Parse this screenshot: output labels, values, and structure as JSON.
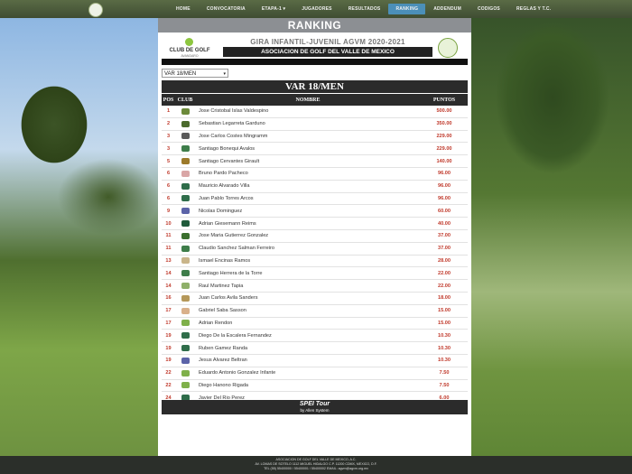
{
  "nav": {
    "items": [
      "HOME",
      "CONVOCATORIA",
      "ETAPA-1",
      "JUGADORES",
      "RESULTADOS",
      "RANKING",
      "ADDENDUM",
      "CODIGOS",
      "REGLAS Y T.C."
    ],
    "active": "RANKING",
    "dropdown_marker": "▾"
  },
  "page": {
    "title": "RANKING",
    "club_logo_text": "CLUB DE GOLF",
    "club_logo_sub": "AVANDARO",
    "gira_title": "GIRA INFANTIL-JUVENIL AGVM 2020-2021",
    "asociacion": "ASOCIACION DE GOLF DEL VALLE DE MEXICO",
    "category_select": "VAR 18/MEN",
    "category_title": "VAR 18/MEN"
  },
  "table": {
    "headers": [
      "POS",
      "CLUB",
      "NOMBRE",
      "PUNTOS"
    ],
    "rows": [
      {
        "pos": "1",
        "name": "Jose Cristobal Islas Valdespino",
        "pts": "500.00",
        "club_color": "#6c8a3a"
      },
      {
        "pos": "2",
        "name": "Sebastian Legarreta Garduno",
        "pts": "350.00",
        "club_color": "#4b6a2c"
      },
      {
        "pos": "3",
        "name": "Jose Carlos Costes Mingramm",
        "pts": "229.00",
        "club_color": "#5a5a5a"
      },
      {
        "pos": "3",
        "name": "Santiago Bonequi Avalos",
        "pts": "229.00",
        "club_color": "#3e7d4a"
      },
      {
        "pos": "5",
        "name": "Santiago Cervantes Girault",
        "pts": "140.00",
        "club_color": "#9c7a2a"
      },
      {
        "pos": "6",
        "name": "Bruno Pardo Pacheco",
        "pts": "96.00",
        "club_color": "#d9a6a6"
      },
      {
        "pos": "6",
        "name": "Mauricio Alvarado Villa",
        "pts": "96.00",
        "club_color": "#2f6d4a"
      },
      {
        "pos": "6",
        "name": "Juan Pablo Torres Arcos",
        "pts": "96.00",
        "club_color": "#2f6d4a"
      },
      {
        "pos": "9",
        "name": "Nicolas Dominguez",
        "pts": "60.00",
        "club_color": "#5b63a8"
      },
      {
        "pos": "10",
        "name": "Adrian Giesemann Reims",
        "pts": "40.00",
        "club_color": "#1f5a3a"
      },
      {
        "pos": "11",
        "name": "Jose Maria Gutierrez Gonzalez",
        "pts": "37.00",
        "club_color": "#3b6f2e"
      },
      {
        "pos": "11",
        "name": "Claudio Sanchez Salman Ferreiro",
        "pts": "37.00",
        "club_color": "#3e7d4a"
      },
      {
        "pos": "13",
        "name": "Ismael Encinas Ramos",
        "pts": "28.00",
        "club_color": "#c9b58a"
      },
      {
        "pos": "14",
        "name": "Santiago Herrera de la Torre",
        "pts": "22.00",
        "club_color": "#3e7d4a"
      },
      {
        "pos": "14",
        "name": "Raul Martinez Tapia",
        "pts": "22.00",
        "club_color": "#8fb06a"
      },
      {
        "pos": "16",
        "name": "Juan Carlos Avila Sanders",
        "pts": "18.00",
        "club_color": "#b5985a"
      },
      {
        "pos": "17",
        "name": "Gabriel Saba Sasson",
        "pts": "15.00",
        "club_color": "#d9b08a"
      },
      {
        "pos": "17",
        "name": "Adrian Rendon",
        "pts": "15.00",
        "club_color": "#7fb04a"
      },
      {
        "pos": "19",
        "name": "Diego De la Escalera Fernandez",
        "pts": "10.30",
        "club_color": "#2f6d4a"
      },
      {
        "pos": "19",
        "name": "Ruben Gamez Randa",
        "pts": "10.30",
        "club_color": "#2f6d4a"
      },
      {
        "pos": "19",
        "name": "Jesus Alvarez Beltran",
        "pts": "10.30",
        "club_color": "#5b63a8"
      },
      {
        "pos": "22",
        "name": "Eduardo Antonio Gonzalez Infante",
        "pts": "7.50",
        "club_color": "#7fb04a"
      },
      {
        "pos": "22",
        "name": "Diego Hanono Rigada",
        "pts": "7.50",
        "club_color": "#7fb04a"
      },
      {
        "pos": "24",
        "name": "Javier Del Rio Perez",
        "pts": "6.00",
        "club_color": "#2f6d4a"
      }
    ]
  },
  "sponsor": {
    "line1": "SPEI Tour",
    "line2": "by Allen System"
  },
  "footer": {
    "line1": "ASOCIACION DE GOLF DEL VALLE DE MEXICO, A.C.",
    "line2": "AV. LOMAS DE SOTELO 1112 MIGUEL HIDALGO C.P. 11200 CDMX, MEXICO, D.F.",
    "line3": "TEL (55) 55400000 / 55400001 / 55400002  EMAIL: agvm@agvm.org.mx"
  }
}
